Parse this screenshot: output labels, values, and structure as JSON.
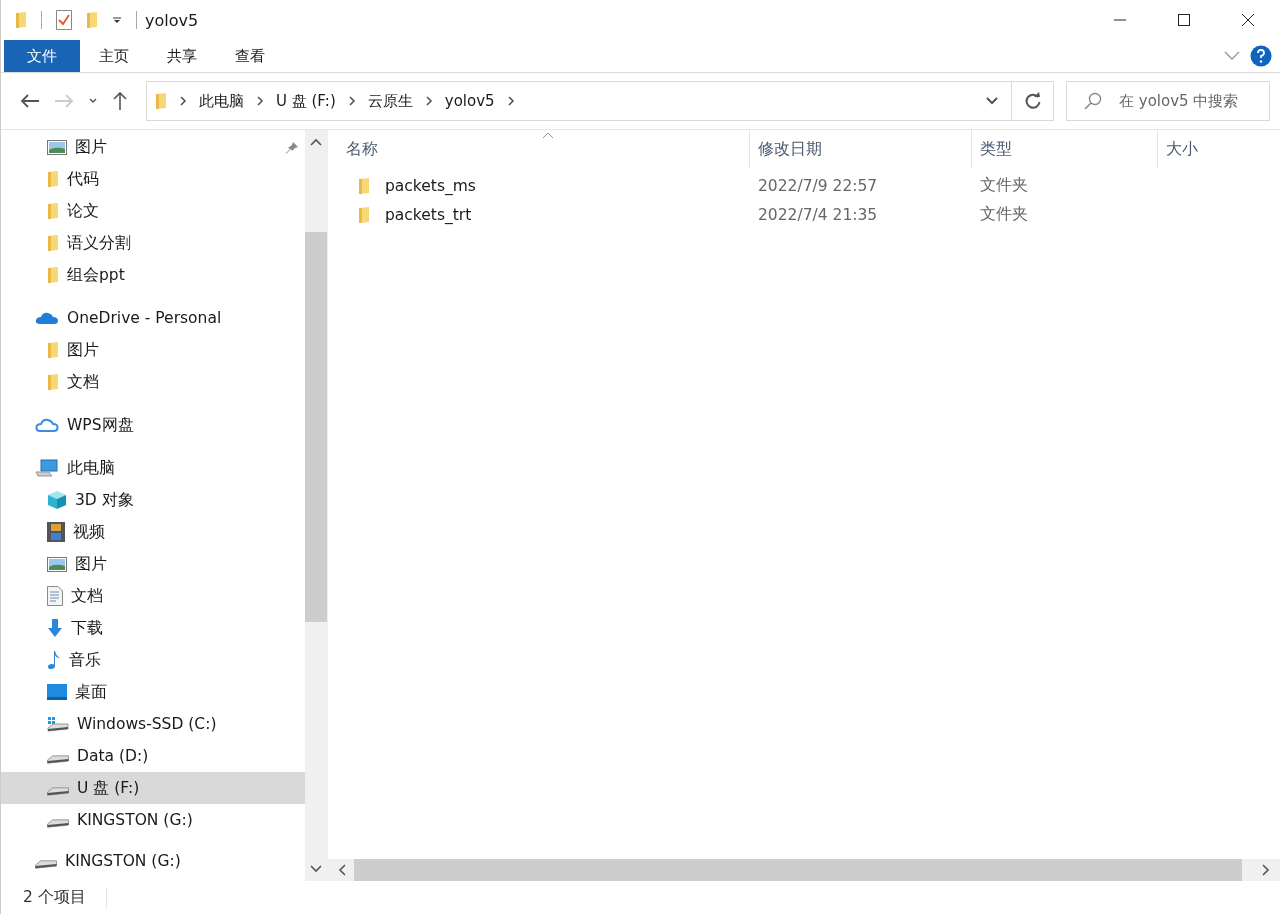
{
  "window": {
    "title": "yolov5"
  },
  "ribbon": {
    "tabs": [
      {
        "label": "文件",
        "kind": "file",
        "selected": false
      },
      {
        "label": "主页",
        "kind": "tab",
        "selected": false
      },
      {
        "label": "共享",
        "kind": "tab",
        "selected": false
      },
      {
        "label": "查看",
        "kind": "tab",
        "selected": false
      }
    ]
  },
  "address_bar": {
    "path": [
      "此电脑",
      "U 盘 (F:)",
      "云原生",
      "yolov5"
    ],
    "search": {
      "placeholder": "在 yolov5 中搜索"
    }
  },
  "sidebar": {
    "quick_access": [
      {
        "label": "图片",
        "kind": "pictures",
        "pinned": true,
        "selected": false
      },
      {
        "label": "代码",
        "kind": "folder",
        "pinned": false,
        "selected": false
      },
      {
        "label": "论文",
        "kind": "folder",
        "pinned": false,
        "selected": false
      },
      {
        "label": "语义分割",
        "kind": "folder",
        "pinned": false,
        "selected": false
      },
      {
        "label": "组会ppt",
        "kind": "folder",
        "pinned": false,
        "selected": false
      }
    ],
    "items": [
      {
        "label": "OneDrive - Personal",
        "kind": "onedrive",
        "selected": false,
        "children": [
          {
            "label": "图片",
            "kind": "folder",
            "selected": false
          },
          {
            "label": "文档",
            "kind": "folder",
            "selected": false
          }
        ]
      },
      {
        "label": "WPS网盘",
        "kind": "wps",
        "selected": false
      },
      {
        "label": "此电脑",
        "kind": "pc",
        "selected": false,
        "children": [
          {
            "label": "3D 对象",
            "kind": "cube",
            "selected": false
          },
          {
            "label": "视频",
            "kind": "video",
            "selected": false
          },
          {
            "label": "图片",
            "kind": "pictures",
            "selected": false
          },
          {
            "label": "文档",
            "kind": "document",
            "selected": false
          },
          {
            "label": "下载",
            "kind": "download",
            "selected": false
          },
          {
            "label": "音乐",
            "kind": "music",
            "selected": false
          },
          {
            "label": "桌面",
            "kind": "desktop",
            "selected": false
          },
          {
            "label": "Windows-SSD (C:)",
            "kind": "windrive",
            "selected": false
          },
          {
            "label": "Data (D:)",
            "kind": "drive",
            "selected": false
          },
          {
            "label": "U 盘 (F:)",
            "kind": "drive",
            "selected": true
          },
          {
            "label": "KINGSTON (G:)",
            "kind": "drive",
            "selected": false
          }
        ]
      },
      {
        "label": "KINGSTON (G:)",
        "kind": "drive",
        "selected": false
      }
    ]
  },
  "file_list": {
    "columns": [
      "名称",
      "修改日期",
      "类型",
      "大小"
    ],
    "rows": [
      {
        "name": "packets_ms",
        "modified": "2022/7/9 22:57",
        "type": "文件夹"
      },
      {
        "name": "packets_trt",
        "modified": "2022/7/4 21:35",
        "type": "文件夹"
      }
    ]
  },
  "status_bar": {
    "item_count": "2 个项目"
  }
}
